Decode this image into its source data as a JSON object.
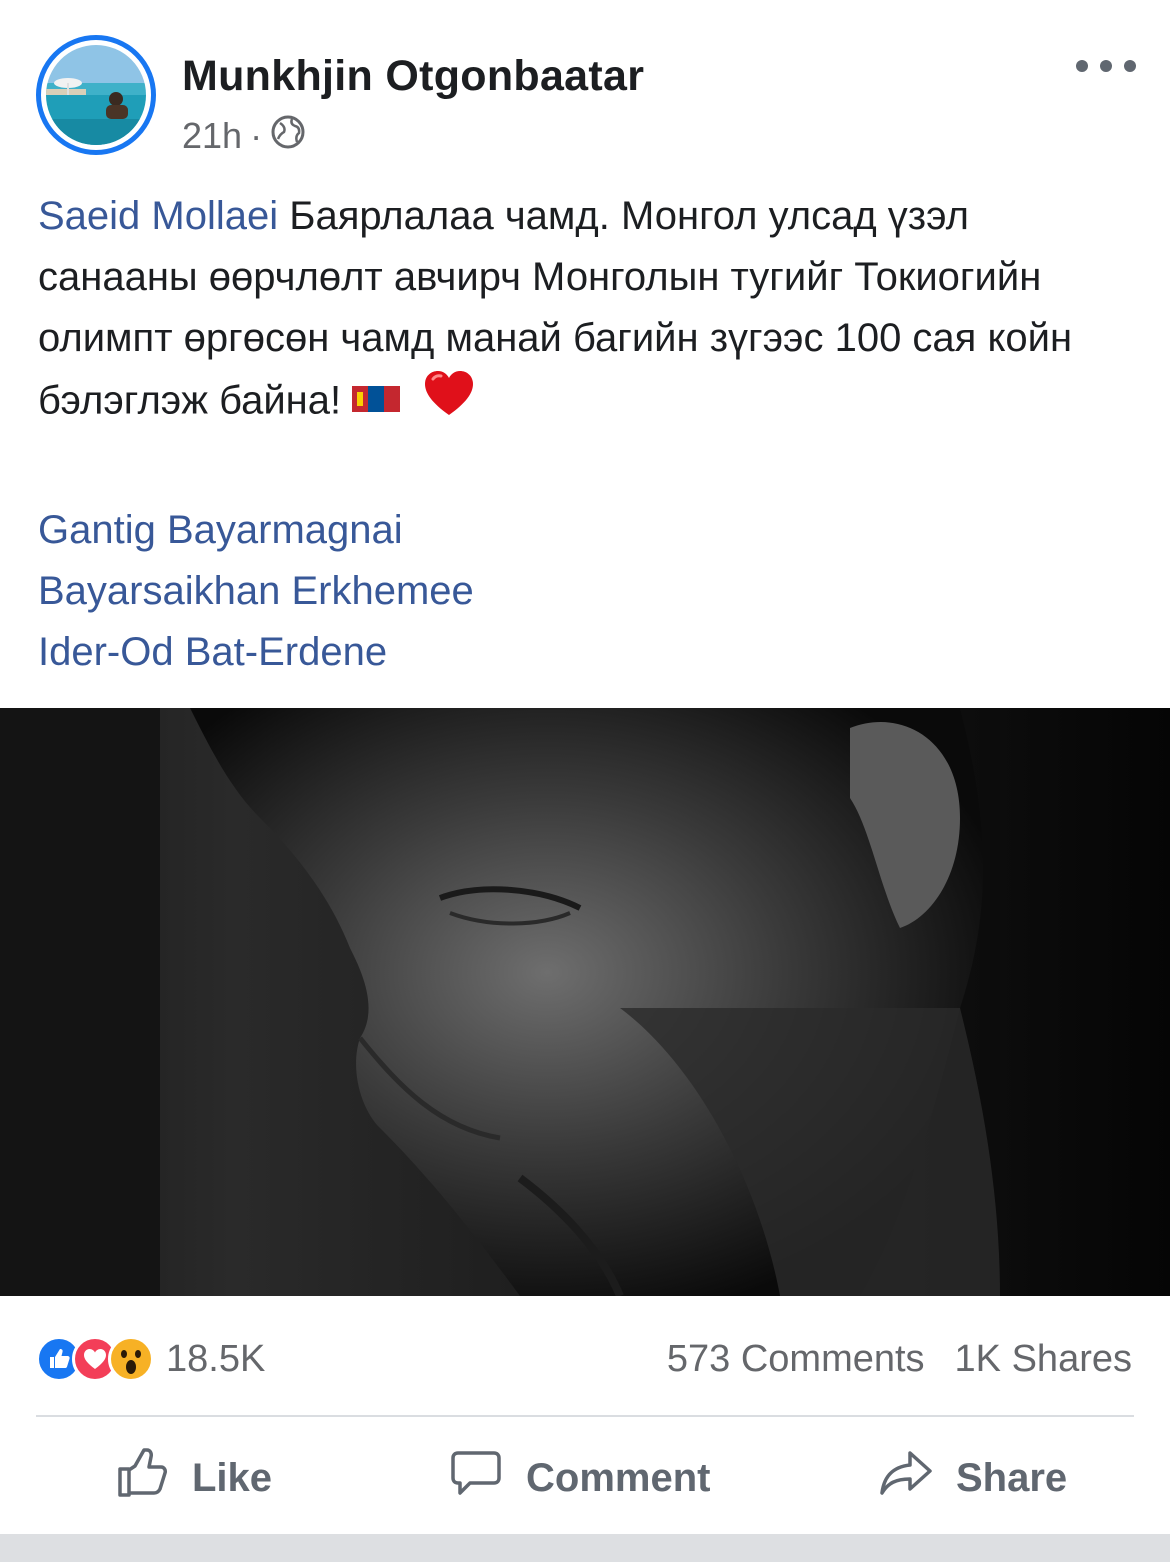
{
  "post": {
    "author": "Munkhjin Otgonbaatar",
    "time": "21h",
    "separator": "·",
    "text_mention": "Saeid Mollaei",
    "text_body": " Баярлалаа чамд. Монгол улсад үзэл санааны өөрчлөлт авчирч Монголын тугийг Токиогийн олимпт өргөсөн чамд манай багийн зүгээс 100 сая койн бэлэглэж байна! ",
    "tags": [
      "Gantig Bayarmagnai",
      "Bayarsaikhan Erkhemee",
      "Ider-Od Bat-Erdene"
    ]
  },
  "stats": {
    "reactions": "18.5K",
    "comments": "573 Comments",
    "shares": "1K Shares"
  },
  "actions": {
    "like": "Like",
    "comment": "Comment",
    "share": "Share"
  },
  "icons": {
    "more": "more-icon",
    "globe": "globe-icon",
    "flag": "mongolia-flag-emoji",
    "heart": "red-heart-emoji",
    "reactions": [
      "like-reaction-icon",
      "love-reaction-icon",
      "wow-reaction-icon"
    ]
  },
  "colors": {
    "brand": "#1877f2",
    "link": "#385898",
    "secondary_text": "#65676b",
    "love": "#f33e58",
    "wow": "#f7b125"
  }
}
